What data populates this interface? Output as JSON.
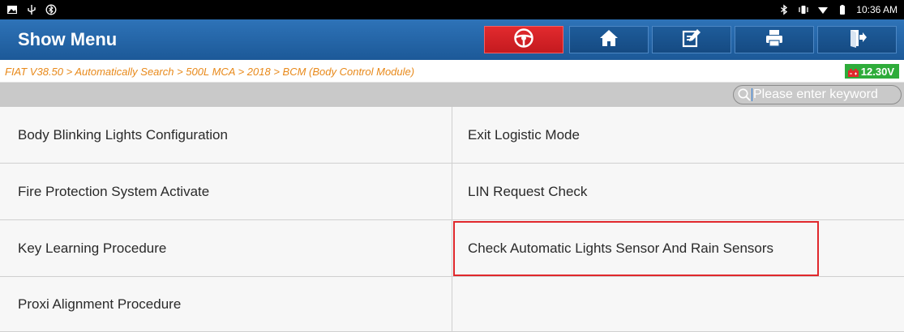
{
  "status_bar": {
    "time": "10:36 AM",
    "left_icons": [
      "image-icon",
      "usb-icon",
      "bluetooth-circle-icon"
    ],
    "right_icons": [
      "bluetooth-icon",
      "vibrate-icon",
      "wifi-icon",
      "battery-icon"
    ]
  },
  "header": {
    "title": "Show Menu",
    "buttons": [
      {
        "name": "vehicle-connect",
        "icon": "steering-wheel-icon",
        "color": "#d8242a"
      },
      {
        "name": "home",
        "icon": "home-icon"
      },
      {
        "name": "edit",
        "icon": "edit-icon"
      },
      {
        "name": "print",
        "icon": "printer-icon"
      },
      {
        "name": "exit",
        "icon": "exit-icon"
      }
    ]
  },
  "breadcrumb": {
    "path": "FIAT V38.50 > Automatically Search > 500L MCA > 2018 > BCM (Body Control Module)",
    "voltage": "12.30V"
  },
  "search": {
    "placeholder": "Please enter keyword"
  },
  "menu": {
    "left": [
      "Body Blinking Lights Configuration",
      "Fire Protection System Activate",
      "Key Learning Procedure",
      "Proxi Alignment Procedure"
    ],
    "right": [
      "Exit Logistic Mode",
      "LIN Request Check",
      "Check Automatic Lights Sensor And Rain Sensors",
      ""
    ],
    "highlighted": "Check Automatic Lights Sensor And Rain Sensors"
  },
  "colors": {
    "header": "#1f5f9f",
    "accent_red": "#e0282c",
    "breadcrumb": "#e8891a",
    "voltage_green": "#2eac3a"
  }
}
